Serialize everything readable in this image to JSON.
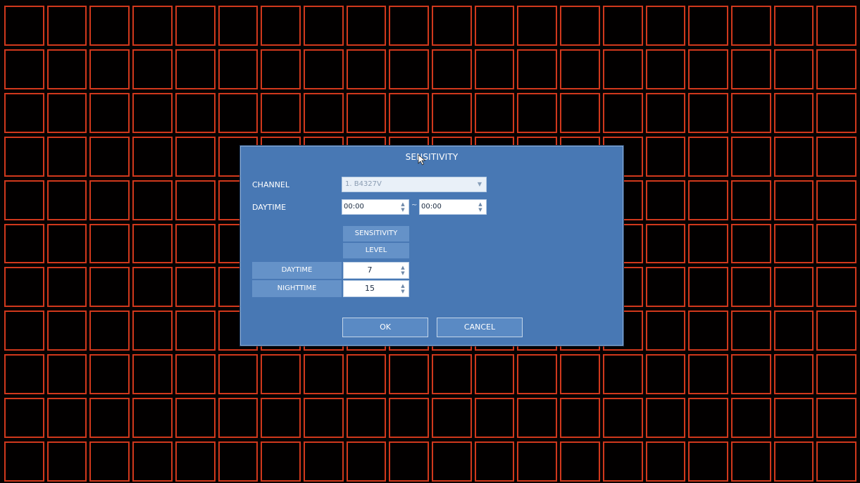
{
  "dialog": {
    "title": "SENSITIVITY",
    "channel_label": "CHANNEL",
    "channel_value": "1. B4327V",
    "daytime_label": "DAYTIME",
    "daytime_start": "00:00",
    "daytime_end": "00:00",
    "range_separator": "~",
    "table": {
      "header_line1": "SENSITIVITY",
      "header_line2": "LEVEL",
      "rows": [
        {
          "label": "DAYTIME",
          "value": "7"
        },
        {
          "label": "NIGHTTIME",
          "value": "15"
        }
      ]
    },
    "ok_label": "OK",
    "cancel_label": "CANCEL"
  },
  "colors": {
    "grid_border": "#d0381c",
    "dialog_bg": "#4878b4",
    "table_header_bg": "#6592c8"
  },
  "icons": {
    "dropdown": "chevron-down-icon",
    "spinner": "up-down-arrows-icon",
    "cursor": "mouse-pointer-icon"
  }
}
